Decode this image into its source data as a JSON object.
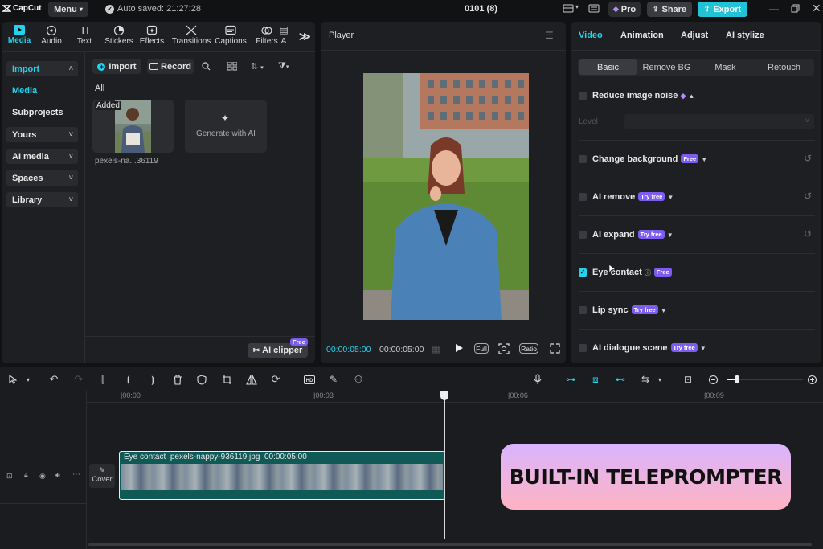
{
  "app": {
    "logo_text": "CapCut",
    "menu_label": "Menu",
    "autosave": "Auto saved: 21:27:28",
    "project_title": "0101 (8)",
    "pro_label": "Pro",
    "share_label": "Share",
    "export_label": "Export"
  },
  "media_tabs": [
    {
      "label": "Media",
      "icon": "media-icon"
    },
    {
      "label": "Audio",
      "icon": "audio-icon"
    },
    {
      "label": "Text",
      "icon": "text-icon"
    },
    {
      "label": "Stickers",
      "icon": "stickers-icon"
    },
    {
      "label": "Effects",
      "icon": "effects-icon"
    },
    {
      "label": "Transitions",
      "icon": "transitions-icon"
    },
    {
      "label": "Captions",
      "icon": "captions-icon"
    },
    {
      "label": "Filters",
      "icon": "filters-icon"
    },
    {
      "label": "A",
      "icon": "adjust-icon"
    }
  ],
  "sidebar": {
    "import": "Import",
    "media": "Media",
    "subprojects": "Subprojects",
    "yours": "Yours",
    "ai_media": "AI media",
    "spaces": "Spaces",
    "library": "Library"
  },
  "media_panel": {
    "import_btn": "Import",
    "record_btn": "Record",
    "filter_all": "All",
    "added_tag": "Added",
    "file_name": "pexels-na...36119",
    "generate_label": "Generate with AI",
    "ai_clipper": "AI clipper",
    "ai_clipper_badge": "Free"
  },
  "player": {
    "title": "Player",
    "current_time": "00:00:05:00",
    "total_time": "00:00:05:00",
    "full_label": "Full",
    "ratio_label": "Ratio"
  },
  "inspector": {
    "tabs": [
      "Video",
      "Animation",
      "Adjust",
      "AI stylize"
    ],
    "subtabs": [
      "Basic",
      "Remove BG",
      "Mask",
      "Retouch"
    ],
    "noise": {
      "label": "Reduce image noise",
      "level_label": "Level"
    },
    "rows": [
      {
        "label": "Change background",
        "badge": "Free",
        "checked": false
      },
      {
        "label": "AI remove",
        "badge": "Try free",
        "checked": false
      },
      {
        "label": "AI expand",
        "badge": "Try free",
        "checked": false
      },
      {
        "label": "Eye contact",
        "badge": "Free",
        "checked": true
      },
      {
        "label": "Lip sync",
        "badge": "Try free",
        "checked": false
      },
      {
        "label": "AI dialogue scene",
        "badge": "Try free",
        "checked": false
      }
    ]
  },
  "timeline": {
    "ticks": [
      "|00:00",
      "|00:03",
      "|00:06",
      "|00:09"
    ],
    "cover_label": "Cover",
    "clip_effect": "Eye contact",
    "clip_file": "pexels-nappy-936119.jpg",
    "clip_duration": "00:00:05:00"
  },
  "overlay": {
    "banner_text": "BUILT-IN TELEPROMPTER"
  },
  "colors": {
    "accent": "#22d3ee",
    "export_bg": "#22c3d6",
    "badge_purple": "#7d5cf0",
    "clip_teal": "#0f5a57",
    "banner_top": "#d9b4ff",
    "banner_bottom": "#ffb3c2"
  }
}
